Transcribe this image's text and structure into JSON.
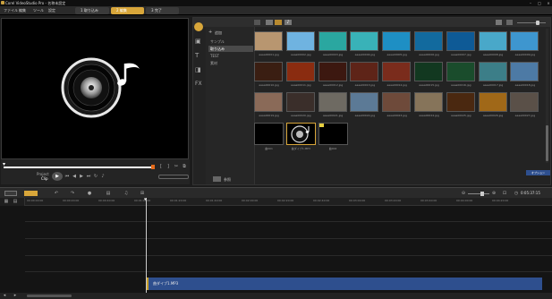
{
  "app": {
    "title": "Corel VideoStudio Pro - 名称未設定"
  },
  "menu": {
    "items": [
      "ファイル",
      "編集",
      "ツール",
      "設定"
    ]
  },
  "steps": {
    "capture": "1 取り込み",
    "edit": "2 編集",
    "share": "3 完了"
  },
  "preview": {
    "project_label": "Project",
    "clip_label": "Clip"
  },
  "library": {
    "add_label": "追加",
    "categories": [
      "サンプル",
      "取り込み",
      "TEST",
      "素材"
    ],
    "browse_label": "参照",
    "options_label": "オプション",
    "thumbnails": [
      {
        "caption": "aaaa00001.jpg",
        "color": "#b89670"
      },
      {
        "caption": "aaaa00002.jpg",
        "color": "#6fb3e0"
      },
      {
        "caption": "aaaa00003.jpg",
        "color": "#2aa7a0"
      },
      {
        "caption": "aaaa00004.jpg",
        "color": "#39b2b8"
      },
      {
        "caption": "aaaa00005.jpg",
        "color": "#1e8fc4"
      },
      {
        "caption": "aaaa00006.jpg",
        "color": "#126a9e"
      },
      {
        "caption": "aaaa00007.jpg",
        "color": "#0e5a96"
      },
      {
        "caption": "aaaa00008.jpg",
        "color": "#49a8c9"
      },
      {
        "caption": "aaaa00009.jpg",
        "color": "#3e96cf"
      },
      {
        "caption": "aaaa00010.jpg",
        "color": "#3a1e12"
      },
      {
        "caption": "aaaa00011.jpg",
        "color": "#8a2c10"
      },
      {
        "caption": "aaaa00012.jpg",
        "color": "#3c1810"
      },
      {
        "caption": "aaaa00013.jpg",
        "color": "#5e2418"
      },
      {
        "caption": "aaaa00014.jpg",
        "color": "#7a2c1c"
      },
      {
        "caption": "aaaa00015.jpg",
        "color": "#123820"
      },
      {
        "caption": "aaaa00016.jpg",
        "color": "#1a4c2c"
      },
      {
        "caption": "aaaa00017.jpg",
        "color": "#3c7e88"
      },
      {
        "caption": "aaaa00018.jpg",
        "color": "#4d7aa5"
      },
      {
        "caption": "aaaa00019.jpg",
        "color": "#8a6a58"
      },
      {
        "caption": "aaaa00020.jpg",
        "color": "#3a2e2a"
      },
      {
        "caption": "aaaa00021.jpg",
        "color": "#6e6a62"
      },
      {
        "caption": "aaaa00022.jpg",
        "color": "#5c7a96"
      },
      {
        "caption": "aaaa00023.jpg",
        "color": "#6e4a3a"
      },
      {
        "caption": "aaaa00024.jpg",
        "color": "#86745a"
      },
      {
        "caption": "aaaa00025.jpg",
        "color": "#4a2810"
      },
      {
        "caption": "aaaa00026.jpg",
        "color": "#a06818"
      },
      {
        "caption": "aaaa00027.jpg",
        "color": "#5a5048"
      },
      {
        "caption": "曲001",
        "color": "#000000"
      },
      {
        "caption": "曲ダイブ1.MP3",
        "color": "#000000"
      },
      {
        "caption": "曲002",
        "color": "#000000"
      }
    ]
  },
  "timeline": {
    "timecode": "0:05:37:15",
    "clip_label": "曲ダイブ1.MP3",
    "ruler_marks": [
      "00:00:00:00",
      "00:00:20:00",
      "00:00:40:00",
      "00:01:00:00",
      "00:01:20:00",
      "00:01:40:00",
      "00:02:00:00",
      "00:02:20:00",
      "00:02:40:00",
      "00:03:00:00",
      "00:03:20:00",
      "00:03:40:00",
      "00:04:00:00",
      "00:04:20:00"
    ]
  },
  "colors": {
    "accent": "#d8a63a",
    "clip": "#2e4f8e",
    "progress": "#ffffff"
  }
}
